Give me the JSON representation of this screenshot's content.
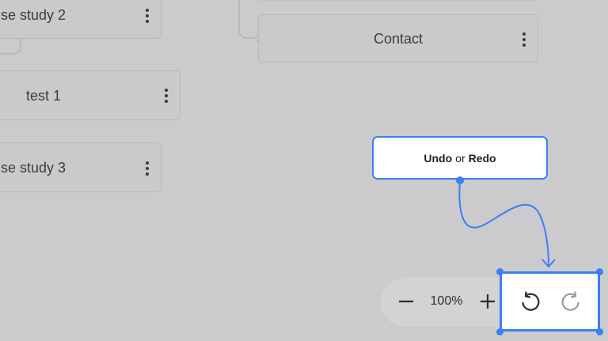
{
  "canvas": {
    "nodes": {
      "case_study_2": "se study 2",
      "contact": "Contact",
      "test_1": "test 1",
      "case_study_3": "se study 3"
    }
  },
  "tooltip": {
    "undo": "Undo",
    "connector": "or",
    "redo": "Redo"
  },
  "zoom": {
    "value": "100%",
    "zoom_out_icon": "minus-icon",
    "zoom_in_icon": "plus-icon"
  },
  "history": {
    "undo_icon": "undo-icon",
    "redo_icon": "redo-icon",
    "redo_enabled": false
  },
  "colors": {
    "background": "#cbcbcd",
    "accent": "#3b7ff2",
    "node_border": "#b8b8ba",
    "disabled_icon": "#9a9a9c"
  }
}
